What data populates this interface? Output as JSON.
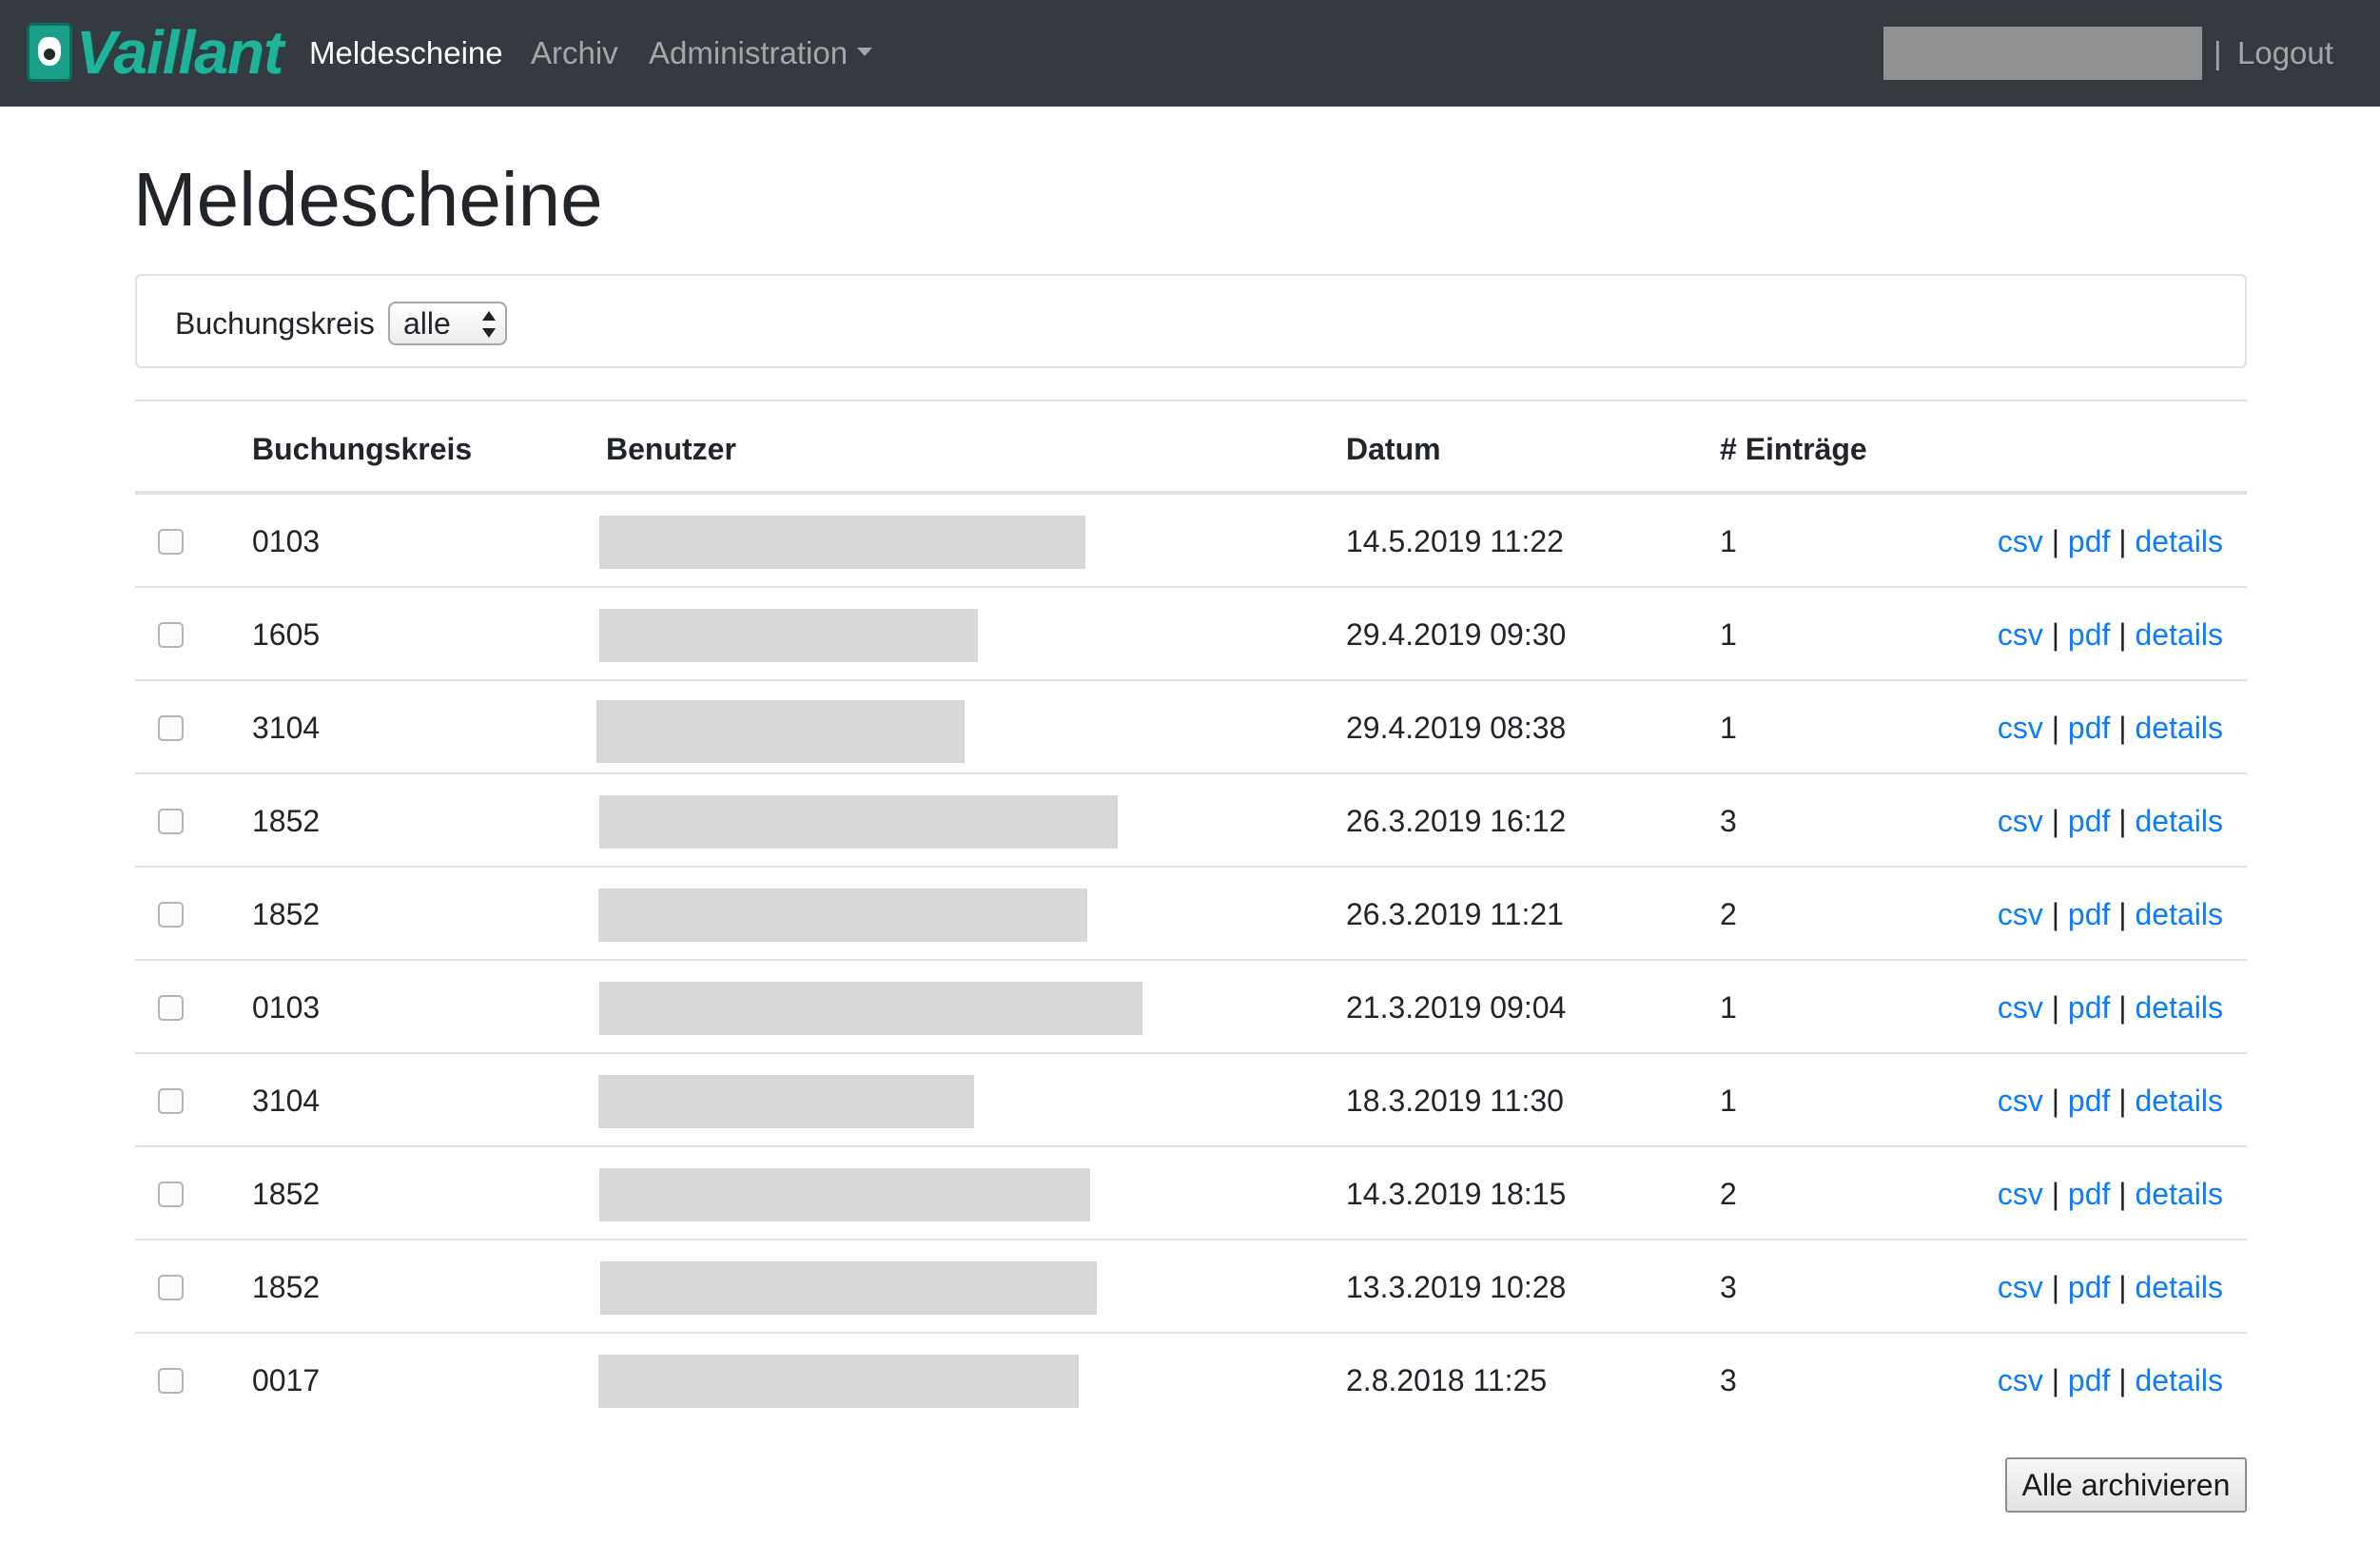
{
  "navbar": {
    "logo_text": "Vaillant",
    "items": [
      {
        "label": "Meldescheine"
      },
      {
        "label": "Archiv"
      },
      {
        "label": "Administration"
      }
    ],
    "separator": "|",
    "logout_label": "Logout"
  },
  "page": {
    "title": "Meldescheine"
  },
  "filter": {
    "label": "Buchungskreis",
    "selected": "alle"
  },
  "table": {
    "headers": {
      "buchungskreis": "Buchungskreis",
      "benutzer": "Benutzer",
      "datum": "Datum",
      "eintraege": "# Einträge"
    },
    "rows": [
      {
        "buchungskreis": "0103",
        "datum": "14.5.2019 11:22",
        "eintraege": "1"
      },
      {
        "buchungskreis": "1605",
        "datum": "29.4.2019 09:30",
        "eintraege": "1"
      },
      {
        "buchungskreis": "3104",
        "datum": "29.4.2019 08:38",
        "eintraege": "1"
      },
      {
        "buchungskreis": "1852",
        "datum": "26.3.2019 16:12",
        "eintraege": "3"
      },
      {
        "buchungskreis": "1852",
        "datum": "26.3.2019 11:21",
        "eintraege": "2"
      },
      {
        "buchungskreis": "0103",
        "datum": "21.3.2019 09:04",
        "eintraege": "1"
      },
      {
        "buchungskreis": "3104",
        "datum": "18.3.2019 11:30",
        "eintraege": "1"
      },
      {
        "buchungskreis": "1852",
        "datum": "14.3.2019 18:15",
        "eintraege": "2"
      },
      {
        "buchungskreis": "1852",
        "datum": "13.3.2019 10:28",
        "eintraege": "3"
      },
      {
        "buchungskreis": "0017",
        "datum": "2.8.2018 11:25",
        "eintraege": "3"
      }
    ],
    "actions": {
      "csv": "csv",
      "pdf": "pdf",
      "details": "details",
      "separator": "|"
    }
  },
  "archive_all_label": "Alle archivieren"
}
